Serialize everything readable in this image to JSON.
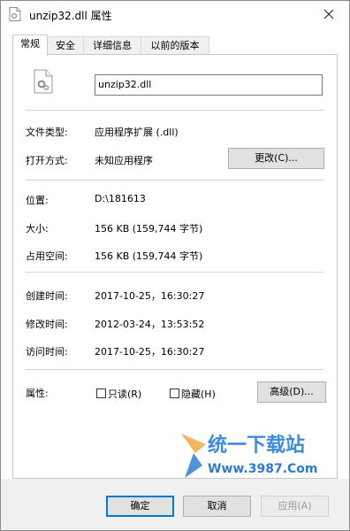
{
  "window": {
    "title": "unzip32.dll 属性"
  },
  "tabs": [
    {
      "label": "常规"
    },
    {
      "label": "安全"
    },
    {
      "label": "详细信息"
    },
    {
      "label": "以前的版本"
    }
  ],
  "general": {
    "filename": "unzip32.dll",
    "file_type_label": "文件类型:",
    "file_type_value": "应用程序扩展 (.dll)",
    "opens_with_label": "打开方式:",
    "opens_with_value": "未知应用程序",
    "change_button": "更改(C)...",
    "location_label": "位置:",
    "location_value": "D:\\181613",
    "size_label": "大小:",
    "size_value": "156 KB (159,744 字节)",
    "size_on_disk_label": "占用空间:",
    "size_on_disk_value": "156 KB (159,744 字节)",
    "created_label": "创建时间:",
    "created_value": "2017-10-25，16:30:27",
    "modified_label": "修改时间:",
    "modified_value": "2012-03-24，13:53:52",
    "accessed_label": "访问时间:",
    "accessed_value": "2017-10-25，16:30:27",
    "attributes_label": "属性:",
    "readonly_label": "只读(R)",
    "hidden_label": "隐藏(H)",
    "advanced_button": "高级(D)..."
  },
  "watermark": {
    "brand": "统一下载站",
    "url": "Www.3987.Com"
  },
  "footer": {
    "ok": "确定",
    "cancel": "取消",
    "apply": "应用(A)"
  }
}
